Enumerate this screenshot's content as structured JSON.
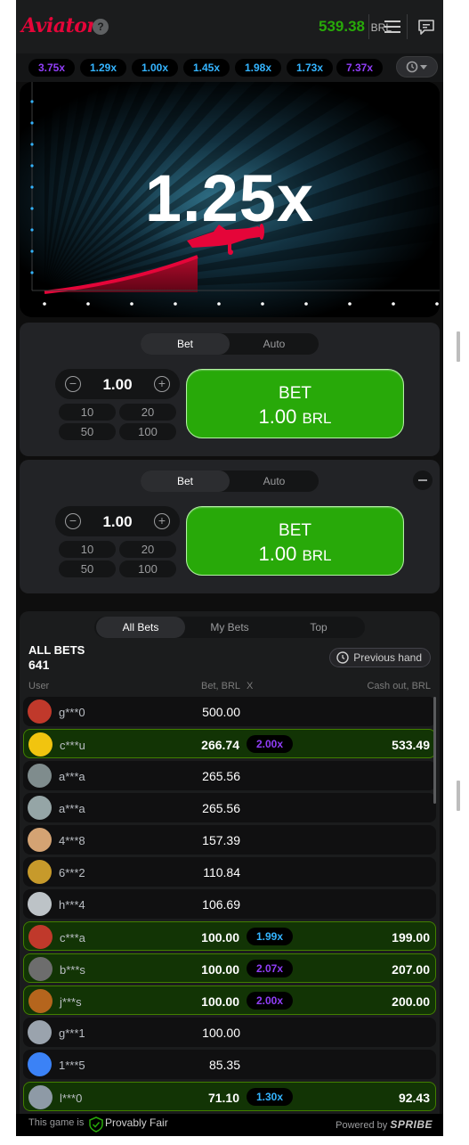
{
  "header": {
    "logo": "Aviator",
    "help_icon": "question-icon",
    "balance": "539.38",
    "currency": "BRL",
    "menu_icon": "hamburger-menu-icon",
    "chat_icon": "chat-icon"
  },
  "multipliers": {
    "items": [
      {
        "value": "3.75x",
        "color": "#913ef8"
      },
      {
        "value": "1.29x",
        "color": "#34b4ff"
      },
      {
        "value": "1.00x",
        "color": "#34b4ff"
      },
      {
        "value": "1.45x",
        "color": "#34b4ff"
      },
      {
        "value": "1.98x",
        "color": "#34b4ff"
      },
      {
        "value": "1.73x",
        "color": "#34b4ff"
      },
      {
        "value": "7.37x",
        "color": "#913ef8"
      }
    ],
    "history_icon": "history-icon"
  },
  "game": {
    "coefficient": "1.25x",
    "plane_icon": "airplane-icon"
  },
  "bet_panels": [
    {
      "tabs": [
        "Bet",
        "Auto"
      ],
      "active_tab": "Bet",
      "stake": "1.00",
      "quick_amounts": [
        "10",
        "20",
        "50",
        "100"
      ],
      "button_label": "BET",
      "button_amount": "1.00",
      "button_currency": "BRL"
    },
    {
      "tabs": [
        "Bet",
        "Auto"
      ],
      "active_tab": "Bet",
      "stake": "1.00",
      "quick_amounts": [
        "10",
        "20",
        "50",
        "100"
      ],
      "button_label": "BET",
      "button_amount": "1.00",
      "button_currency": "BRL"
    }
  ],
  "bets": {
    "tabs": [
      "All Bets",
      "My Bets",
      "Top"
    ],
    "active_tab": "All Bets",
    "title": "ALL BETS",
    "count": "641",
    "previous_hand": "Previous hand",
    "columns": {
      "user": "User",
      "bet": "Bet, BRL",
      "x": "X",
      "cashout": "Cash out, BRL"
    },
    "rows": [
      {
        "user": "g***0",
        "bet": "500.00",
        "x": "",
        "cashout": "",
        "win": false,
        "x_color": ""
      },
      {
        "user": "c***u",
        "bet": "266.74",
        "x": "2.00x",
        "cashout": "533.49",
        "win": true,
        "x_color": "#913ef8"
      },
      {
        "user": "a***a",
        "bet": "265.56",
        "x": "",
        "cashout": "",
        "win": false,
        "x_color": ""
      },
      {
        "user": "a***a",
        "bet": "265.56",
        "x": "",
        "cashout": "",
        "win": false,
        "x_color": ""
      },
      {
        "user": "4***8",
        "bet": "157.39",
        "x": "",
        "cashout": "",
        "win": false,
        "x_color": ""
      },
      {
        "user": "6***2",
        "bet": "110.84",
        "x": "",
        "cashout": "",
        "win": false,
        "x_color": ""
      },
      {
        "user": "h***4",
        "bet": "106.69",
        "x": "",
        "cashout": "",
        "win": false,
        "x_color": ""
      },
      {
        "user": "c***a",
        "bet": "100.00",
        "x": "1.99x",
        "cashout": "199.00",
        "win": true,
        "x_color": "#34b4ff"
      },
      {
        "user": "b***s",
        "bet": "100.00",
        "x": "2.07x",
        "cashout": "207.00",
        "win": true,
        "x_color": "#913ef8"
      },
      {
        "user": "j***s",
        "bet": "100.00",
        "x": "2.00x",
        "cashout": "200.00",
        "win": true,
        "x_color": "#913ef8"
      },
      {
        "user": "g***1",
        "bet": "100.00",
        "x": "",
        "cashout": "",
        "win": false,
        "x_color": ""
      },
      {
        "user": "1***5",
        "bet": "85.35",
        "x": "",
        "cashout": "",
        "win": false,
        "x_color": ""
      },
      {
        "user": "l***0",
        "bet": "71.10",
        "x": "1.30x",
        "cashout": "92.43",
        "win": true,
        "x_color": "#34b4ff"
      }
    ]
  },
  "footer": {
    "prefix": "This game is",
    "provably_fair": "Provably Fair",
    "powered_by": "Powered by",
    "brand": "SPRIBE"
  }
}
